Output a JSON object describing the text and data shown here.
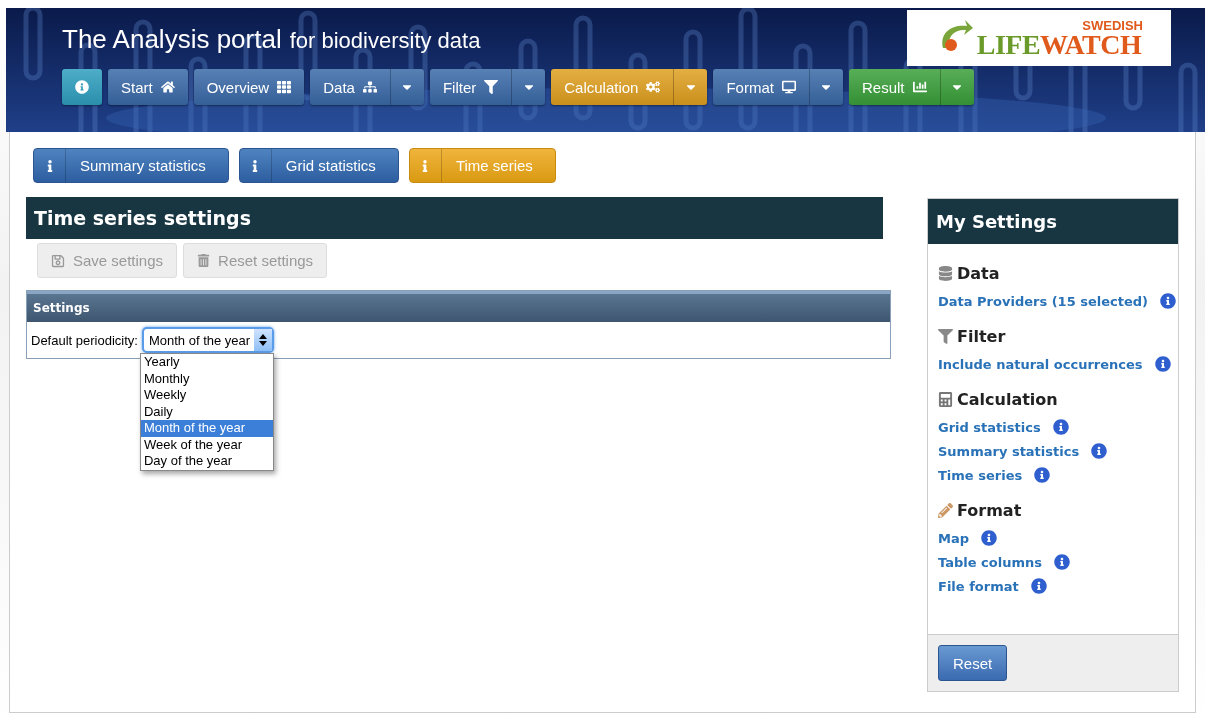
{
  "header": {
    "title": "The Analysis portal",
    "subtitle": "for biodiversity data",
    "logo": {
      "top": "SWEDISH",
      "left": "LIFE",
      "right": "WATCH"
    }
  },
  "nav": [
    {
      "color": "#2f9fbf",
      "dropdown": false
    },
    {
      "label": "Start",
      "color": "#3a6aa8",
      "dropdown": false
    },
    {
      "label": "Overview",
      "color": "#3a6aa8",
      "dropdown": false
    },
    {
      "label": "Data",
      "color": "#3a6aa8",
      "dropdown": true
    },
    {
      "label": "Filter",
      "color": "#3a6aa8",
      "dropdown": true
    },
    {
      "label": "Calculation",
      "color": "#e0a020",
      "dropdown": true
    },
    {
      "label": "Format",
      "color": "#3a6aa8",
      "dropdown": true
    },
    {
      "label": "Result",
      "color": "#3aa03a",
      "dropdown": true
    }
  ],
  "subtabs": [
    {
      "label": "Summary statistics",
      "selected": false
    },
    {
      "label": "Grid statistics",
      "selected": false
    },
    {
      "label": "Time series",
      "selected": true
    }
  ],
  "panel": {
    "title": "Time series settings",
    "buttons": [
      {
        "label": "Save settings",
        "disabled": true
      },
      {
        "label": "Reset settings",
        "disabled": true
      }
    ],
    "section": "Settings",
    "field": {
      "label": "Default periodicity:",
      "value": "Month of the year",
      "expanded": true,
      "options": [
        {
          "label": "Yearly",
          "selected": false
        },
        {
          "label": "Monthly",
          "selected": false
        },
        {
          "label": "Weekly",
          "selected": false
        },
        {
          "label": "Daily",
          "selected": false
        },
        {
          "label": "Month of the year",
          "selected": true
        },
        {
          "label": "Week of the year",
          "selected": false
        },
        {
          "label": "Day of the year",
          "selected": false
        }
      ]
    }
  },
  "sidebar": {
    "title": "My Settings",
    "sections": [
      {
        "heading": "Data",
        "links": [
          "Data Providers (15 selected)"
        ]
      },
      {
        "heading": "Filter",
        "links": [
          "Include natural occurrences"
        ]
      },
      {
        "heading": "Calculation",
        "links": [
          "Grid statistics",
          "Summary statistics",
          "Time series"
        ]
      },
      {
        "heading": "Format",
        "links": [
          "Map",
          "Table columns",
          "File format"
        ]
      }
    ],
    "button": "Reset"
  }
}
